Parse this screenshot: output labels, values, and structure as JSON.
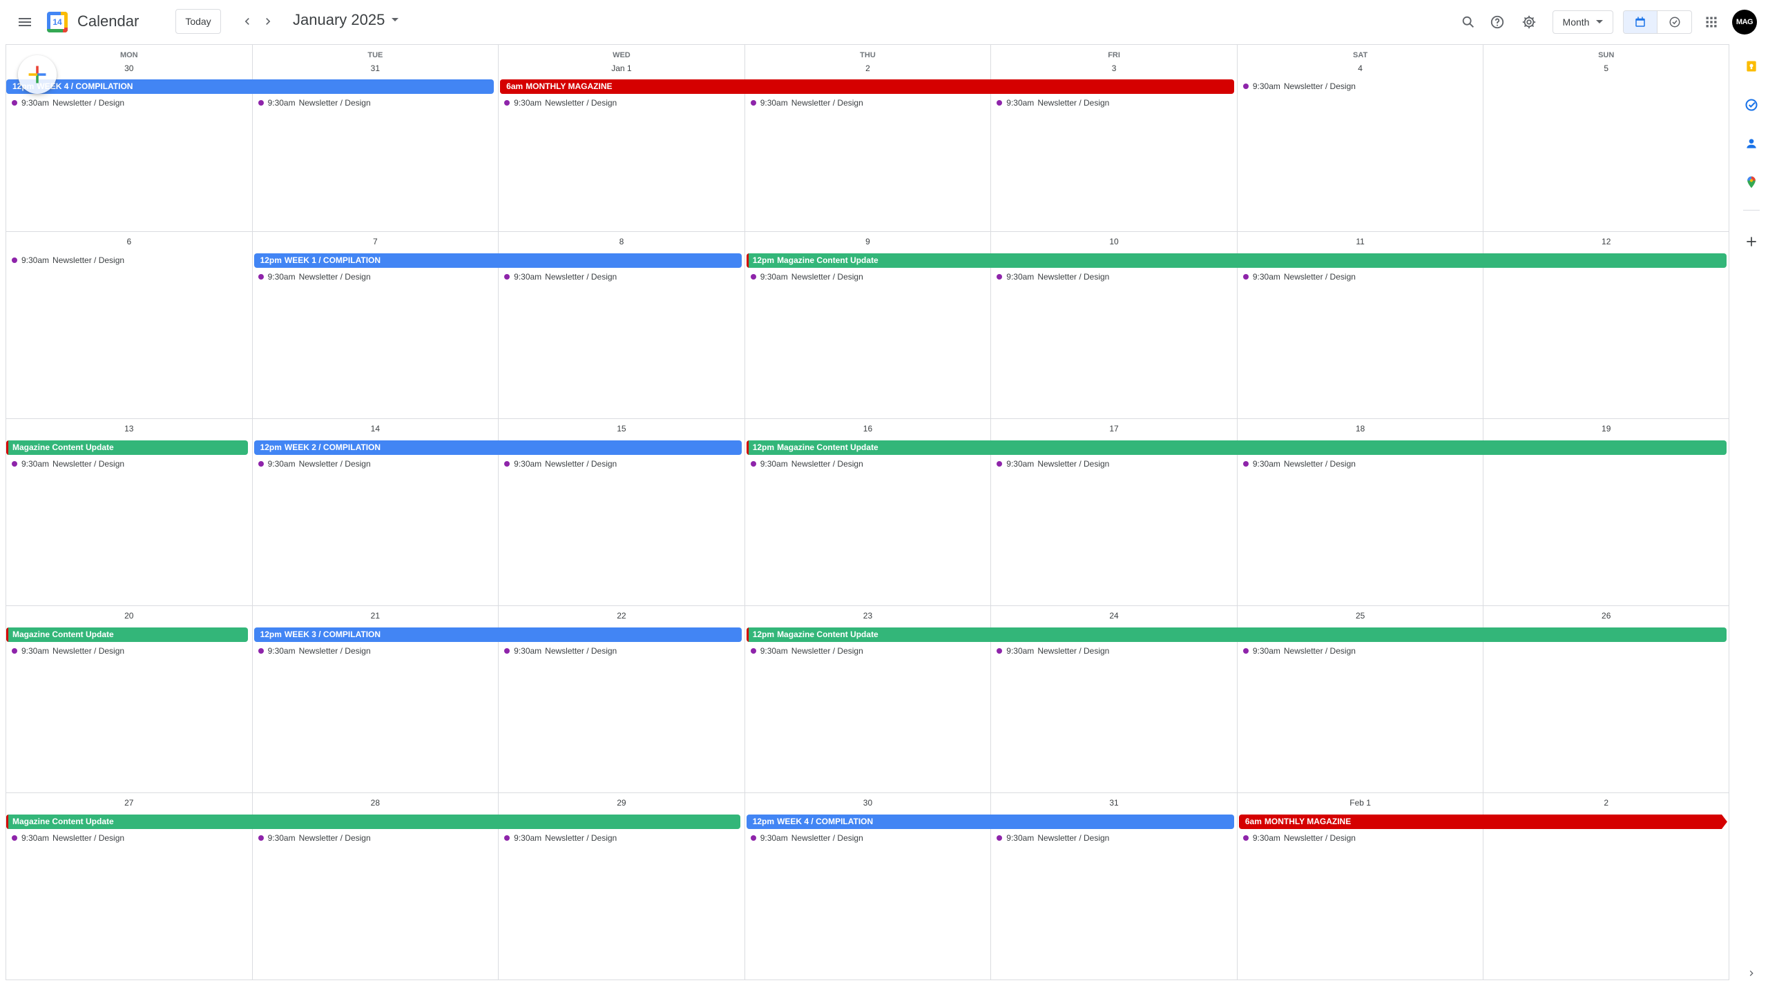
{
  "header": {
    "app_title": "Calendar",
    "logo_day": "14",
    "today_label": "Today",
    "month_label": "January 2025",
    "view_label": "Month",
    "avatar_text": "MAG"
  },
  "colors": {
    "blue": "#4285f4",
    "red": "#d50000",
    "green": "#33b679",
    "dot_purple": "#8e24aa"
  },
  "day_headers": [
    "MON",
    "TUE",
    "WED",
    "THU",
    "FRI",
    "SAT",
    "SUN"
  ],
  "weeks": [
    {
      "days": [
        "30",
        "31",
        "Jan 1",
        "2",
        "3",
        "4",
        "5"
      ],
      "bars": [
        {
          "start": 0,
          "span": 2,
          "color": "blue",
          "time": "12pm",
          "title": "WEEK 4 / COMPILATION"
        },
        {
          "start": 2,
          "span": 3,
          "color": "red",
          "time": "6am",
          "title": "MONTHLY MAGAZINE"
        }
      ],
      "newsletter_days": [
        0,
        1,
        2,
        3,
        4,
        5
      ]
    },
    {
      "days": [
        "6",
        "7",
        "8",
        "9",
        "10",
        "11",
        "12"
      ],
      "bars": [
        {
          "start": 1,
          "span": 2,
          "color": "blue",
          "time": "12pm",
          "title": "WEEK 1 / COMPILATION"
        },
        {
          "start": 3,
          "span": 4,
          "color": "green",
          "time": "12pm",
          "title": "Magazine Content Update"
        }
      ],
      "newsletter_days": [
        0,
        1,
        2,
        3,
        4,
        5
      ]
    },
    {
      "days": [
        "13",
        "14",
        "15",
        "16",
        "17",
        "18",
        "19"
      ],
      "bars": [
        {
          "start": 0,
          "span": 1,
          "color": "green",
          "time": "",
          "title": "Magazine Content Update"
        },
        {
          "start": 1,
          "span": 2,
          "color": "blue",
          "time": "12pm",
          "title": "WEEK 2 / COMPILATION"
        },
        {
          "start": 3,
          "span": 4,
          "color": "green",
          "time": "12pm",
          "title": "Magazine Content Update"
        }
      ],
      "newsletter_days": [
        0,
        1,
        2,
        3,
        4,
        5
      ]
    },
    {
      "days": [
        "20",
        "21",
        "22",
        "23",
        "24",
        "25",
        "26"
      ],
      "bars": [
        {
          "start": 0,
          "span": 1,
          "color": "green",
          "time": "",
          "title": "Magazine Content Update"
        },
        {
          "start": 1,
          "span": 2,
          "color": "blue",
          "time": "12pm",
          "title": "WEEK 3 / COMPILATION"
        },
        {
          "start": 3,
          "span": 4,
          "color": "green",
          "time": "12pm",
          "title": "Magazine Content Update"
        }
      ],
      "newsletter_days": [
        0,
        1,
        2,
        3,
        4,
        5
      ]
    },
    {
      "days": [
        "27",
        "28",
        "29",
        "30",
        "31",
        "Feb 1",
        "2"
      ],
      "bars": [
        {
          "start": 0,
          "span": 3,
          "color": "green",
          "time": "",
          "title": "Magazine Content Update"
        },
        {
          "start": 3,
          "span": 2,
          "color": "blue",
          "time": "12pm",
          "title": "WEEK 4 / COMPILATION"
        },
        {
          "start": 5,
          "span": 2,
          "color": "red",
          "time": "6am",
          "title": "MONTHLY MAGAZINE",
          "continues": true
        }
      ],
      "newsletter_days": [
        0,
        1,
        2,
        3,
        4,
        5
      ]
    }
  ],
  "newsletter_event": {
    "time": "9:30am",
    "title": "Newsletter / Design"
  },
  "side_rail": [
    "keep-icon",
    "tasks-icon",
    "contacts-icon",
    "maps-icon",
    "add-icon",
    "expand-icon"
  ]
}
